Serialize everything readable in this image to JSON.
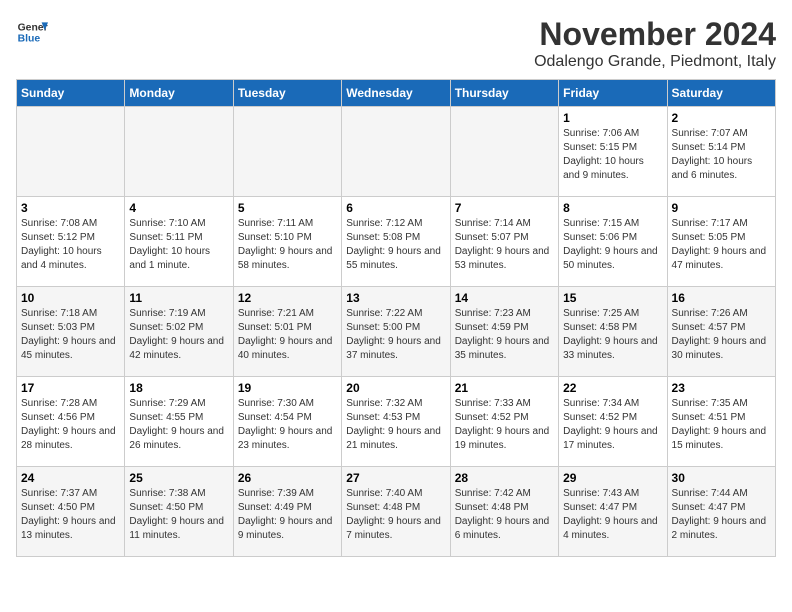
{
  "logo": {
    "line1": "General",
    "line2": "Blue"
  },
  "title": "November 2024",
  "location": "Odalengo Grande, Piedmont, Italy",
  "weekdays": [
    "Sunday",
    "Monday",
    "Tuesday",
    "Wednesday",
    "Thursday",
    "Friday",
    "Saturday"
  ],
  "weeks": [
    [
      {
        "day": "",
        "info": ""
      },
      {
        "day": "",
        "info": ""
      },
      {
        "day": "",
        "info": ""
      },
      {
        "day": "",
        "info": ""
      },
      {
        "day": "",
        "info": ""
      },
      {
        "day": "1",
        "info": "Sunrise: 7:06 AM\nSunset: 5:15 PM\nDaylight: 10 hours and 9 minutes."
      },
      {
        "day": "2",
        "info": "Sunrise: 7:07 AM\nSunset: 5:14 PM\nDaylight: 10 hours and 6 minutes."
      }
    ],
    [
      {
        "day": "3",
        "info": "Sunrise: 7:08 AM\nSunset: 5:12 PM\nDaylight: 10 hours and 4 minutes."
      },
      {
        "day": "4",
        "info": "Sunrise: 7:10 AM\nSunset: 5:11 PM\nDaylight: 10 hours and 1 minute."
      },
      {
        "day": "5",
        "info": "Sunrise: 7:11 AM\nSunset: 5:10 PM\nDaylight: 9 hours and 58 minutes."
      },
      {
        "day": "6",
        "info": "Sunrise: 7:12 AM\nSunset: 5:08 PM\nDaylight: 9 hours and 55 minutes."
      },
      {
        "day": "7",
        "info": "Sunrise: 7:14 AM\nSunset: 5:07 PM\nDaylight: 9 hours and 53 minutes."
      },
      {
        "day": "8",
        "info": "Sunrise: 7:15 AM\nSunset: 5:06 PM\nDaylight: 9 hours and 50 minutes."
      },
      {
        "day": "9",
        "info": "Sunrise: 7:17 AM\nSunset: 5:05 PM\nDaylight: 9 hours and 47 minutes."
      }
    ],
    [
      {
        "day": "10",
        "info": "Sunrise: 7:18 AM\nSunset: 5:03 PM\nDaylight: 9 hours and 45 minutes."
      },
      {
        "day": "11",
        "info": "Sunrise: 7:19 AM\nSunset: 5:02 PM\nDaylight: 9 hours and 42 minutes."
      },
      {
        "day": "12",
        "info": "Sunrise: 7:21 AM\nSunset: 5:01 PM\nDaylight: 9 hours and 40 minutes."
      },
      {
        "day": "13",
        "info": "Sunrise: 7:22 AM\nSunset: 5:00 PM\nDaylight: 9 hours and 37 minutes."
      },
      {
        "day": "14",
        "info": "Sunrise: 7:23 AM\nSunset: 4:59 PM\nDaylight: 9 hours and 35 minutes."
      },
      {
        "day": "15",
        "info": "Sunrise: 7:25 AM\nSunset: 4:58 PM\nDaylight: 9 hours and 33 minutes."
      },
      {
        "day": "16",
        "info": "Sunrise: 7:26 AM\nSunset: 4:57 PM\nDaylight: 9 hours and 30 minutes."
      }
    ],
    [
      {
        "day": "17",
        "info": "Sunrise: 7:28 AM\nSunset: 4:56 PM\nDaylight: 9 hours and 28 minutes."
      },
      {
        "day": "18",
        "info": "Sunrise: 7:29 AM\nSunset: 4:55 PM\nDaylight: 9 hours and 26 minutes."
      },
      {
        "day": "19",
        "info": "Sunrise: 7:30 AM\nSunset: 4:54 PM\nDaylight: 9 hours and 23 minutes."
      },
      {
        "day": "20",
        "info": "Sunrise: 7:32 AM\nSunset: 4:53 PM\nDaylight: 9 hours and 21 minutes."
      },
      {
        "day": "21",
        "info": "Sunrise: 7:33 AM\nSunset: 4:52 PM\nDaylight: 9 hours and 19 minutes."
      },
      {
        "day": "22",
        "info": "Sunrise: 7:34 AM\nSunset: 4:52 PM\nDaylight: 9 hours and 17 minutes."
      },
      {
        "day": "23",
        "info": "Sunrise: 7:35 AM\nSunset: 4:51 PM\nDaylight: 9 hours and 15 minutes."
      }
    ],
    [
      {
        "day": "24",
        "info": "Sunrise: 7:37 AM\nSunset: 4:50 PM\nDaylight: 9 hours and 13 minutes."
      },
      {
        "day": "25",
        "info": "Sunrise: 7:38 AM\nSunset: 4:50 PM\nDaylight: 9 hours and 11 minutes."
      },
      {
        "day": "26",
        "info": "Sunrise: 7:39 AM\nSunset: 4:49 PM\nDaylight: 9 hours and 9 minutes."
      },
      {
        "day": "27",
        "info": "Sunrise: 7:40 AM\nSunset: 4:48 PM\nDaylight: 9 hours and 7 minutes."
      },
      {
        "day": "28",
        "info": "Sunrise: 7:42 AM\nSunset: 4:48 PM\nDaylight: 9 hours and 6 minutes."
      },
      {
        "day": "29",
        "info": "Sunrise: 7:43 AM\nSunset: 4:47 PM\nDaylight: 9 hours and 4 minutes."
      },
      {
        "day": "30",
        "info": "Sunrise: 7:44 AM\nSunset: 4:47 PM\nDaylight: 9 hours and 2 minutes."
      }
    ]
  ]
}
